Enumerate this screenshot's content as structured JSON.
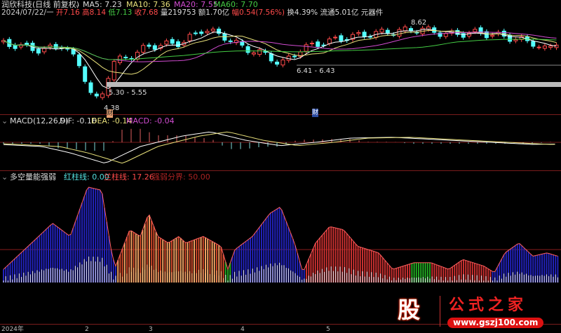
{
  "header": {
    "title": "润欣科技(日线 前复权)",
    "ma5": "MA5: 7.23",
    "ma10": "MA10: 7.36",
    "ma20": "MA20: 7.55",
    "ma60": "MA60: 7.70",
    "date": "2024/07/22/一",
    "open": "开7.16",
    "high": "高8.14",
    "low": "低7.13",
    "close": "收7.68",
    "vol": "量219753",
    "amount": "额1.70亿",
    "change": "幅0.54(7.56%)",
    "turnover": "换4.39%",
    "float": "流通5.01亿",
    "sector": "元器件"
  },
  "annotations": {
    "high": "8.62",
    "low1": "6.41 - 6.43",
    "low2": "5.30 - 5.55",
    "low3": "4.38",
    "cai1": "财",
    "cai2": "财"
  },
  "macd": {
    "title": "MACD(12,26,9)",
    "dif": "DIF: -0.16",
    "dea": "DEA: -0.14",
    "macd": "MACD: -0.04"
  },
  "strength": {
    "title": "多空量能强弱",
    "red": "红柱线: 0.00",
    "blue": "兰柱线: 17.26",
    "divide": "强弱分界: 50.00"
  },
  "xaxis": [
    "2024年",
    "2",
    "3",
    "4",
    "5"
  ],
  "logo": {
    "text": "股",
    "site": "公式之家",
    "url": "www.gszj100.com"
  },
  "colors": {
    "up": "#ff4a4a",
    "down": "#54ffff",
    "ma5": "#ffffff",
    "ma10": "#e8e07a",
    "ma20": "#d24cd2",
    "ma60": "#44cc44"
  },
  "chart_data": {
    "type": "candlestick",
    "price_key": [
      [
        0,
        7.6
      ],
      [
        60,
        7.2
      ],
      [
        90,
        7.5
      ],
      [
        115,
        6.4
      ],
      [
        130,
        5.0
      ],
      [
        142,
        4.6
      ],
      [
        160,
        6.6
      ],
      [
        190,
        7.0
      ],
      [
        210,
        7.4
      ],
      [
        260,
        7.6
      ],
      [
        290,
        8.3
      ],
      [
        320,
        7.9
      ],
      [
        350,
        7.3
      ],
      [
        380,
        7.0
      ],
      [
        400,
        6.5
      ],
      [
        430,
        7.3
      ],
      [
        460,
        7.6
      ],
      [
        500,
        7.9
      ],
      [
        540,
        8.1
      ],
      [
        600,
        8.3
      ],
      [
        640,
        8.0
      ],
      [
        680,
        8.1
      ],
      [
        720,
        7.9
      ],
      [
        760,
        7.6
      ],
      [
        780,
        7.2
      ],
      [
        795,
        7.7
      ]
    ],
    "macd_key": [
      [
        0,
        -0.05
      ],
      [
        60,
        -0.1
      ],
      [
        100,
        -0.25
      ],
      [
        150,
        -0.5
      ],
      [
        200,
        -0.1
      ],
      [
        260,
        0.15
      ],
      [
        300,
        0.25
      ],
      [
        350,
        0.05
      ],
      [
        400,
        -0.08
      ],
      [
        450,
        0.0
      ],
      [
        500,
        0.1
      ],
      [
        560,
        0.12
      ],
      [
        640,
        0.05
      ],
      [
        700,
        0.0
      ],
      [
        760,
        -0.05
      ],
      [
        795,
        -0.04
      ]
    ],
    "strength_key": [
      [
        5,
        20
      ],
      [
        40,
        55
      ],
      [
        75,
        90
      ],
      [
        100,
        70
      ],
      [
        125,
        145
      ],
      [
        145,
        140
      ],
      [
        160,
        40
      ],
      [
        165,
        25
      ],
      [
        185,
        80
      ],
      [
        200,
        70
      ],
      [
        212,
        105
      ],
      [
        225,
        70
      ],
      [
        240,
        60
      ],
      [
        255,
        70
      ],
      [
        265,
        60
      ],
      [
        290,
        70
      ],
      [
        315,
        55
      ],
      [
        325,
        20
      ],
      [
        335,
        50
      ],
      [
        360,
        70
      ],
      [
        385,
        105
      ],
      [
        400,
        115
      ],
      [
        420,
        60
      ],
      [
        432,
        15
      ],
      [
        450,
        60
      ],
      [
        470,
        85
      ],
      [
        490,
        80
      ],
      [
        510,
        55
      ],
      [
        540,
        45
      ],
      [
        560,
        20
      ],
      [
        590,
        30
      ],
      [
        615,
        30
      ],
      [
        640,
        20
      ],
      [
        660,
        35
      ],
      [
        690,
        25
      ],
      [
        705,
        15
      ],
      [
        720,
        45
      ],
      [
        740,
        60
      ],
      [
        760,
        40
      ],
      [
        780,
        45
      ],
      [
        795,
        40
      ]
    ],
    "strength_threshold": 50
  }
}
